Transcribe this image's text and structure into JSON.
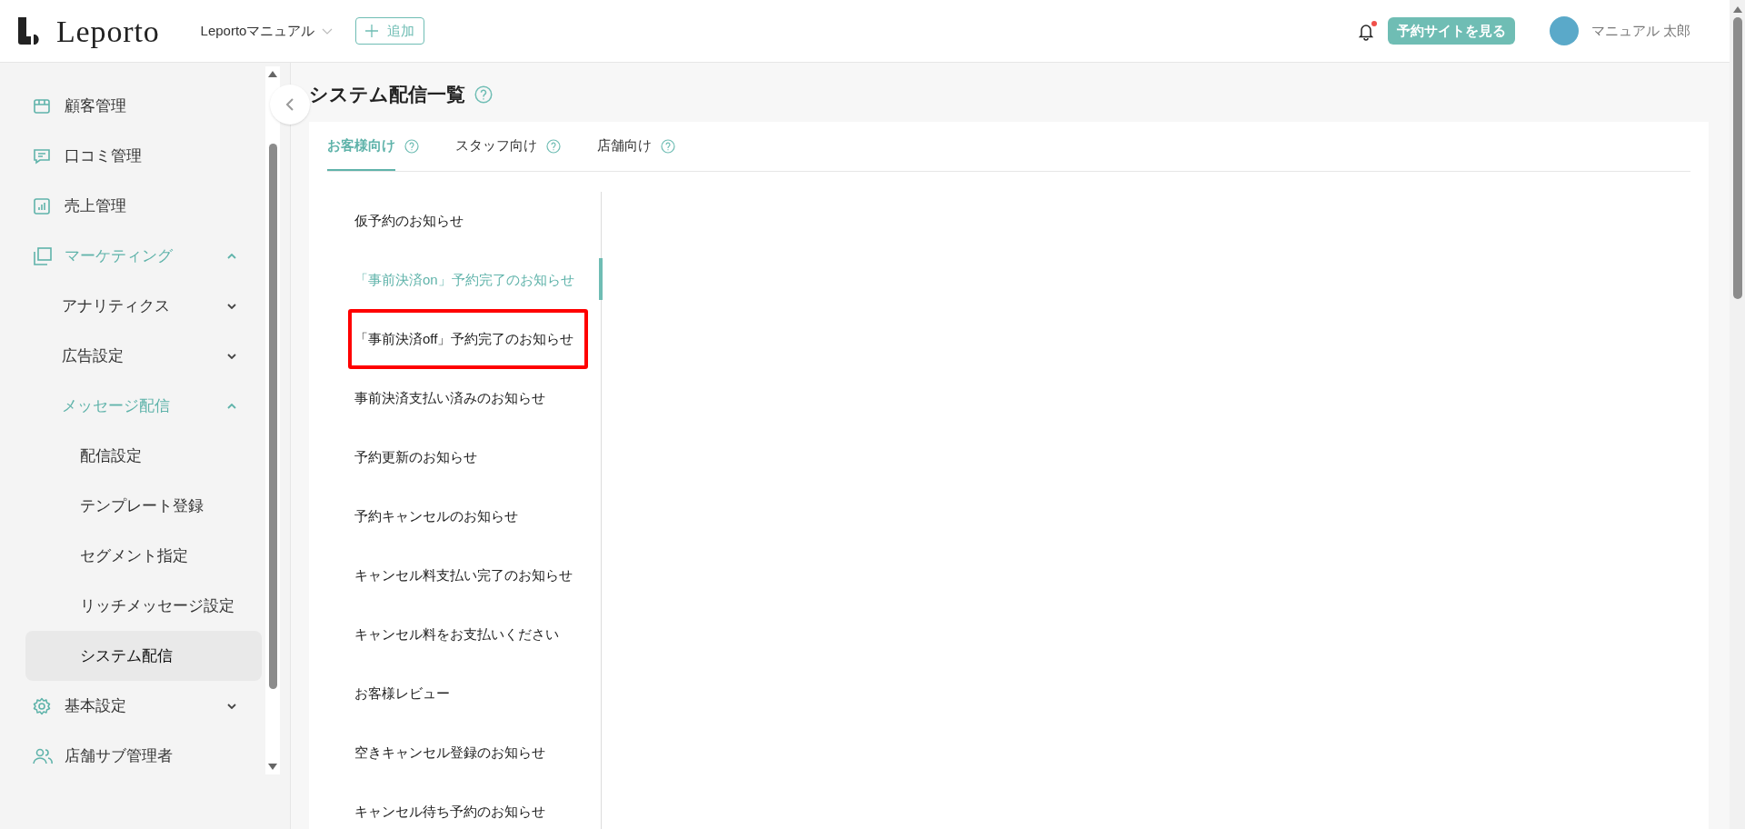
{
  "header": {
    "logo": "Leporto",
    "store_selector": "Leportoマニュアル",
    "add_button": "追加",
    "has_notification": true,
    "site_button": "予約サイトを見る",
    "user_name": "マニュアル 太郎"
  },
  "sidebar": {
    "items": [
      {
        "label": "顧客管理",
        "selected": false
      },
      {
        "label": "口コミ管理",
        "selected": false
      },
      {
        "label": "売上管理",
        "selected": false
      },
      {
        "label": "マーケティング",
        "selected": false,
        "expanded": true,
        "children": [
          {
            "label": "アナリティクス",
            "selected": false,
            "expanded": false
          },
          {
            "label": "広告設定",
            "selected": false,
            "expanded": false
          },
          {
            "label": "メッセージ配信",
            "selected": false,
            "expanded": true,
            "children": [
              {
                "label": "配信設定",
                "selected": false
              },
              {
                "label": "テンプレート登録",
                "selected": false
              },
              {
                "label": "セグメント指定",
                "selected": false
              },
              {
                "label": "リッチメッセージ設定",
                "selected": false
              },
              {
                "label": "システム配信",
                "selected": true
              }
            ]
          }
        ]
      },
      {
        "label": "基本設定",
        "selected": false,
        "expanded": false
      },
      {
        "label": "店舗サブ管理者",
        "selected": false
      }
    ]
  },
  "page": {
    "title": "システム配信一覧",
    "tabs": [
      {
        "label": "お客様向け",
        "selected": true
      },
      {
        "label": "スタッフ向け",
        "selected": false
      },
      {
        "label": "店舗向け",
        "selected": false
      }
    ],
    "notifications": [
      {
        "label": "仮予約のお知らせ",
        "selected": false,
        "highlighted": false
      },
      {
        "label": "「事前決済on」予約完了のお知らせ",
        "selected": true,
        "highlighted": false
      },
      {
        "label": "「事前決済off」予約完了のお知らせ",
        "selected": false,
        "highlighted": true
      },
      {
        "label": "事前決済支払い済みのお知らせ",
        "selected": false,
        "highlighted": false
      },
      {
        "label": "予約更新のお知らせ",
        "selected": false,
        "highlighted": false
      },
      {
        "label": "予約キャンセルのお知らせ",
        "selected": false,
        "highlighted": false
      },
      {
        "label": "キャンセル料支払い完了のお知らせ",
        "selected": false,
        "highlighted": false
      },
      {
        "label": "キャンセル料をお支払いください",
        "selected": false,
        "highlighted": false
      },
      {
        "label": "お客様レビュー",
        "selected": false,
        "highlighted": false
      },
      {
        "label": "空きキャンセル登録のお知らせ",
        "selected": false,
        "highlighted": false
      },
      {
        "label": "キャンセル待ち予約のお知らせ",
        "selected": false,
        "highlighted": false
      }
    ]
  }
}
